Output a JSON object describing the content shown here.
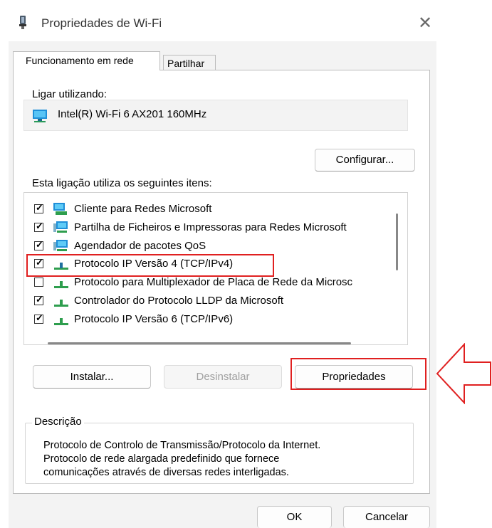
{
  "window": {
    "title": "Propriedades de Wi-Fi",
    "close_glyph": "✕"
  },
  "tabs": [
    {
      "label": "Funcionamento em rede",
      "active": true
    },
    {
      "label": "Partilhar",
      "active": false
    }
  ],
  "connect_using": {
    "label": "Ligar utilizando:",
    "adapter": "Intel(R) Wi-Fi 6 AX201 160MHz",
    "adapter_icon": "network-adapter-icon"
  },
  "configure_label": "Configurar...",
  "items_label": "Esta ligação utiliza os seguintes itens:",
  "items": [
    {
      "checked": true,
      "label": "Cliente para Redes Microsoft",
      "icon": "network-client-icon"
    },
    {
      "checked": true,
      "label": "Partilha de Ficheiros e Impressoras para Redes Microsoft",
      "icon": "network-service-icon"
    },
    {
      "checked": true,
      "label": "Agendador de pacotes QoS",
      "icon": "network-service-icon"
    },
    {
      "checked": true,
      "label": "Protocolo IP Versão 4 (TCP/IPv4)",
      "icon": "protocol-icon"
    },
    {
      "checked": false,
      "label": "Protocolo para Multiplexador de Placa de Rede da Microsc",
      "icon": "protocol-icon"
    },
    {
      "checked": true,
      "label": "Controlador do Protocolo LLDP da Microsoft",
      "icon": "protocol-icon"
    },
    {
      "checked": true,
      "label": "Protocolo IP Versão 6 (TCP/IPv6)",
      "icon": "protocol-icon"
    }
  ],
  "buttons": {
    "install": "Instalar...",
    "uninstall": "Desinstalar",
    "properties": "Propriedades",
    "ok": "OK",
    "cancel": "Cancelar"
  },
  "description": {
    "title": "Descrição",
    "lines": [
      "Protocolo de Controlo de Transmissão/Protocolo da Internet.",
      "Protocolo de rede alargada predefinido que fornece",
      "comunicações através de diversas redes interligadas."
    ]
  },
  "highlight_color": "#e02020"
}
